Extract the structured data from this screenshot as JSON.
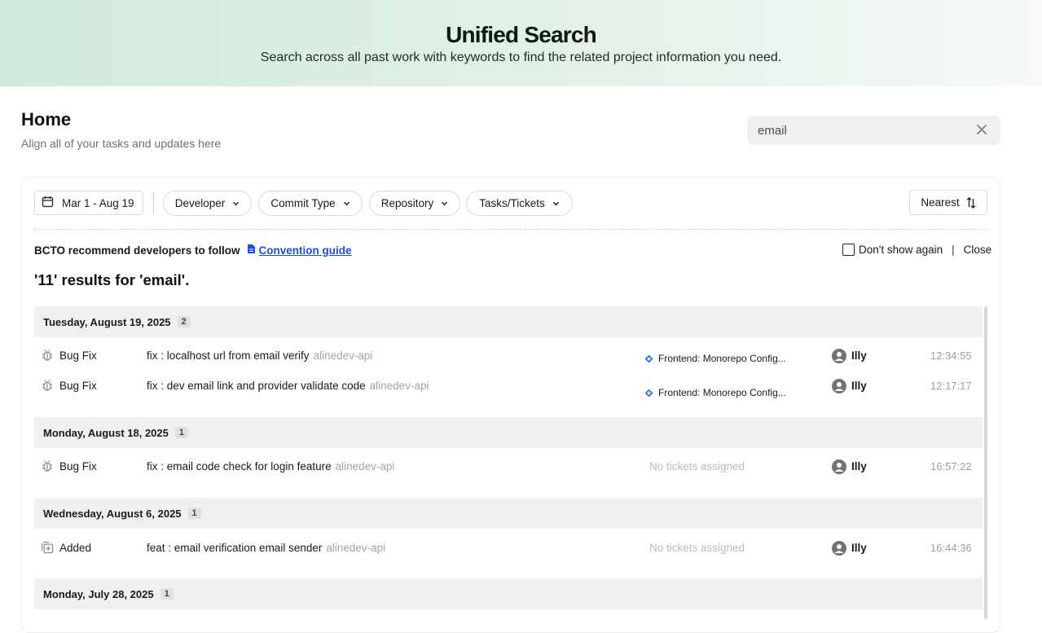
{
  "banner": {
    "title": "Unified Search",
    "subtitle": "Search across all past work with keywords to find the related project information you need."
  },
  "page": {
    "title": "Home",
    "subtitle": "Align all of your tasks and updates here"
  },
  "search": {
    "value": "email",
    "clear_icon": "close-icon"
  },
  "filters": {
    "date_range": "Mar 1 - Aug 19",
    "developer": "Developer",
    "commit_type": "Commit Type",
    "repository": "Repository",
    "tasks": "Tasks/Tickets",
    "sort": "Nearest"
  },
  "notice": {
    "text": "BCTO recommend developers to follow",
    "link": "Convention guide",
    "dont_show": "Don't show again",
    "separator": "|",
    "close": "Close"
  },
  "results_summary": "'11' results for 'email'.",
  "groups": [
    {
      "date": "Tuesday, August 19, 2025",
      "count": "2",
      "rows": [
        {
          "type": "Bug Fix",
          "icon": "bug-icon",
          "message": "fix : localhost url from email verify",
          "repo": "alinedev-api",
          "ticket": "Frontend: Monorepo Config...",
          "user": "Illy",
          "time": "12:34:55"
        },
        {
          "type": "Bug Fix",
          "icon": "bug-icon",
          "message": "fix : dev email link and provider validate code",
          "repo": "alinedev-api",
          "ticket": "Frontend: Monorepo Config...",
          "user": "Illy",
          "time": "12:17:17"
        }
      ]
    },
    {
      "date": "Monday, August 18, 2025",
      "count": "1",
      "rows": [
        {
          "type": "Bug Fix",
          "icon": "bug-icon",
          "message": "fix : email code check for login feature",
          "repo": "alinedev-api",
          "ticket": "No tickets assigned",
          "user": "Illy",
          "time": "16:57:22"
        }
      ]
    },
    {
      "date": "Wednesday, August 6, 2025",
      "count": "1",
      "rows": [
        {
          "type": "Added",
          "icon": "add-file-icon",
          "message": "feat : email verification email sender",
          "repo": "alinedev-api",
          "ticket": "No tickets assigned",
          "user": "Illy",
          "time": "16:44:36"
        }
      ]
    },
    {
      "date": "Monday, July 28, 2025",
      "count": "1",
      "rows": []
    }
  ],
  "colors": {
    "accent_link": "#1d4fd8",
    "ticket_diamond": "#2f7be8"
  }
}
